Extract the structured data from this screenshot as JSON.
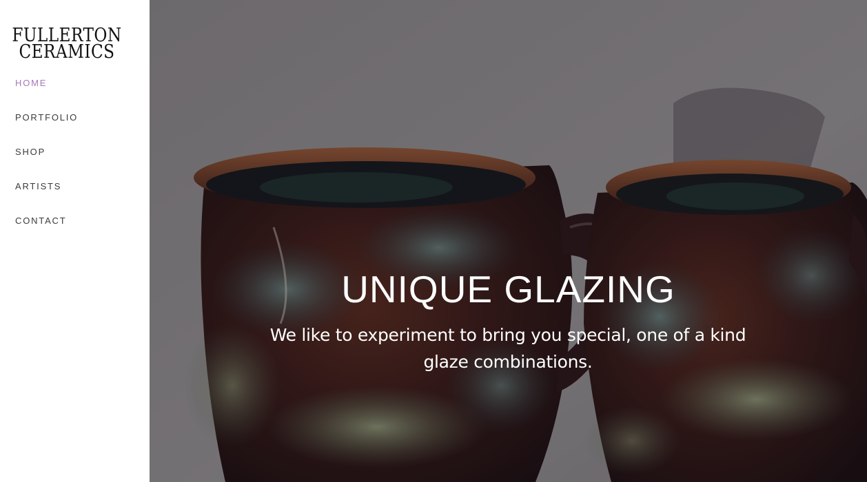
{
  "logo": {
    "line1": "FULLERTON",
    "line2": "CERAMICS"
  },
  "nav": {
    "items": [
      {
        "label": "HOME",
        "active": true
      },
      {
        "label": "PORTFOLIO",
        "active": false
      },
      {
        "label": "SHOP",
        "active": false
      },
      {
        "label": "ARTISTS",
        "active": false
      },
      {
        "label": "CONTACT",
        "active": false
      }
    ]
  },
  "hero": {
    "title": "UNIQUE GLAZING",
    "subtitle": "We like to experiment to bring you special, one of a kind glaze combinations.",
    "image": "ceramic-mugs-photo"
  },
  "colors": {
    "nav_active": "#a678b8",
    "nav_default": "#3a3a3a",
    "hero_text": "#ffffff",
    "sidebar_bg": "#ffffff"
  }
}
